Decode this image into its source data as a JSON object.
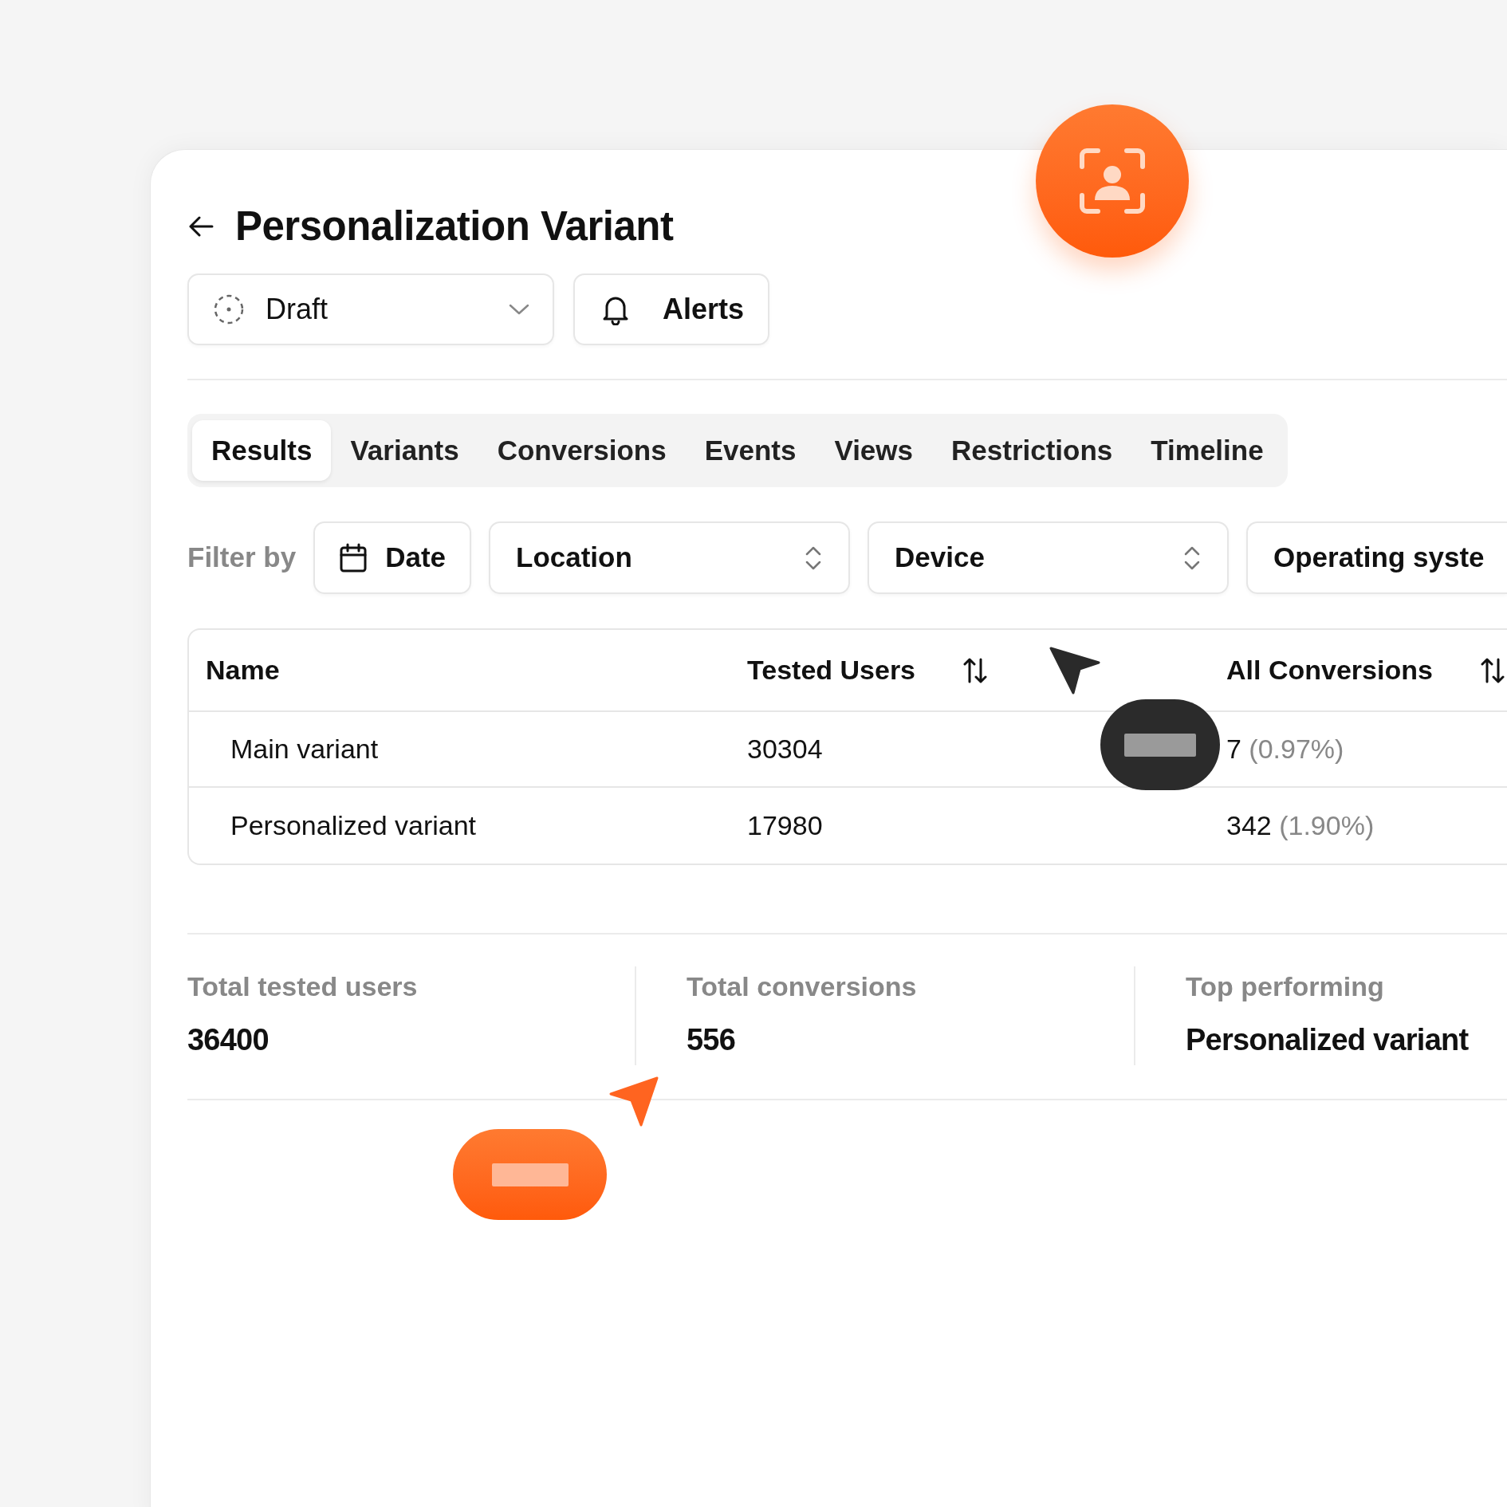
{
  "header": {
    "title": "Personalization Variant"
  },
  "status_select": {
    "value": "Draft"
  },
  "alerts_button": {
    "label": "Alerts"
  },
  "tabs": [
    {
      "label": "Results",
      "selected": true
    },
    {
      "label": "Variants",
      "selected": false
    },
    {
      "label": "Conversions",
      "selected": false
    },
    {
      "label": "Events",
      "selected": false
    },
    {
      "label": "Views",
      "selected": false
    },
    {
      "label": "Restrictions",
      "selected": false
    },
    {
      "label": "Timeline",
      "selected": false
    }
  ],
  "filters": {
    "label": "Filter by",
    "items": [
      {
        "kind": "date",
        "label": "Date"
      },
      {
        "kind": "select",
        "label": "Location"
      },
      {
        "kind": "select",
        "label": "Device"
      },
      {
        "kind": "select",
        "label": "Operating syste"
      }
    ]
  },
  "table": {
    "columns": [
      {
        "label": "Name",
        "sortable": false
      },
      {
        "label": "Tested Users",
        "sortable": true
      },
      {
        "label": "All Conversions",
        "sortable": true
      }
    ],
    "rows": [
      {
        "name": "Main variant",
        "tested_users": "30304",
        "conversions": "7",
        "conversion_rate": "(0.97%)"
      },
      {
        "name": "Personalized variant",
        "tested_users": "17980",
        "conversions": "342",
        "conversion_rate": "(1.90%)"
      }
    ]
  },
  "summary": [
    {
      "label": "Total tested users",
      "value": "36400"
    },
    {
      "label": "Total conversions",
      "value": "556"
    },
    {
      "label": "Top performing",
      "value": "Personalized variant"
    }
  ]
}
